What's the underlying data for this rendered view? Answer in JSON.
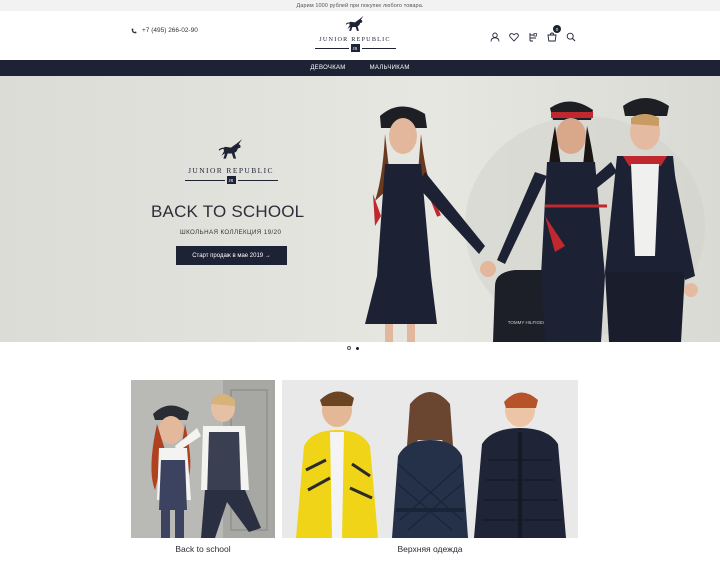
{
  "promo": {
    "text": "Дарим 1000 рублей при покупке любого товара."
  },
  "header": {
    "phone": "+7 (495) 266-02-90",
    "logo_text": "JUNIOR REPUBLIC",
    "logo_monogram": "JR",
    "cart_count": "0"
  },
  "icons": [
    "phone-icon",
    "user-icon",
    "heart-icon",
    "compare-icon",
    "cart-icon",
    "search-icon"
  ],
  "nav": {
    "items": [
      {
        "label": "ДЕВОЧКАМ"
      },
      {
        "label": "МАЛЬЧИКАМ"
      }
    ]
  },
  "hero": {
    "logo_text": "JUNIOR REPUBLIC",
    "logo_monogram": "JR",
    "title": "BACK TO SCHOOL",
    "subtitle": "ШКОЛЬНАЯ КОЛЛЕКЦИЯ 19/20",
    "button": "Старт продаж в мае 2019 →",
    "backpack_text": "TOMMY HILFIGER"
  },
  "slider": {
    "count": 2,
    "active": 1
  },
  "categories": [
    {
      "label": "Back to school"
    },
    {
      "label": "Верхняя одежда"
    }
  ],
  "colors": {
    "navy": "#1d2234",
    "accent_red": "#c0282f",
    "coat_yellow": "#f0d418"
  }
}
